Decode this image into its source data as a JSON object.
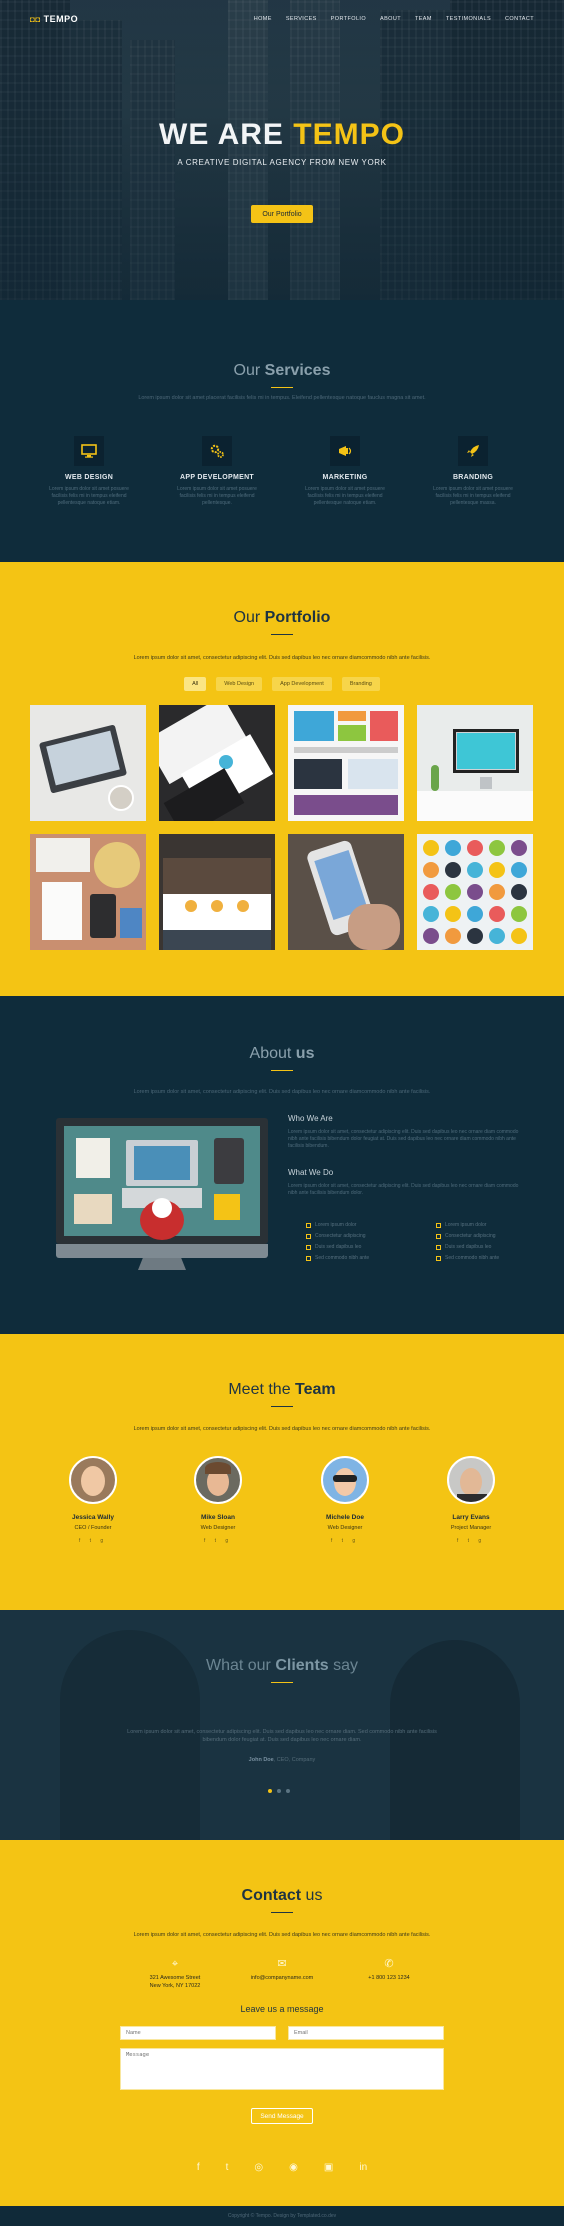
{
  "nav": {
    "logo_mark": "◘◘",
    "logo_text": "TEMPO",
    "items": [
      "HOME",
      "SERVICES",
      "PORTFOLIO",
      "ABOUT",
      "TEAM",
      "TESTIMONIALS",
      "CONTACT"
    ]
  },
  "hero": {
    "title_a": "WE ARE ",
    "title_b": "TEMPO",
    "subtitle": "A CREATIVE DIGITAL AGENCY FROM NEW YORK",
    "button": "Our Portfolio"
  },
  "services": {
    "title_a": "Our ",
    "title_b": "Services",
    "lead": "Lorem ipsum dolor sit amet placerat facilisis felis mi in tempus. Eleifend pellentesque natoque fauclus magna sit amet.",
    "items": [
      {
        "icon": "monitor-icon",
        "title": "WEB DESIGN",
        "text": "Lorem ipsum dolor sit amet posuere facilisis felis mi in tempus eleifend pellentesque natoque etiam."
      },
      {
        "icon": "cogs-icon",
        "title": "APP DEVELOPMENT",
        "text": "Lorem ipsum dolor sit amet posuere facilisis felis mi in tempus eleifend pellentesque."
      },
      {
        "icon": "megaphone-icon",
        "title": "MARKETING",
        "text": "Lorem ipsum dolor sit amet posuere facilisis felis mi in tempus eleifend pellentesque natoque etiam."
      },
      {
        "icon": "rocket-icon",
        "title": "BRANDING",
        "text": "Lorem ipsum dolor sit amet posuere facilisis felis mi in tempus eleifend pellentesque massa."
      }
    ]
  },
  "portfolio": {
    "title_a": "Our ",
    "title_b": "Portfolio",
    "lead": "Lorem ipsum dolor sit amet, consectetur adipiscing elit. Duis sed dapibus leo nec ornare diamcommodo nibh ante facilisis.",
    "filters": [
      "All",
      "Web Design",
      "App Development",
      "Branding"
    ]
  },
  "about": {
    "title_a": "About ",
    "title_b": "us",
    "lead": "Lorem ipsum dolor sit amet, consectetur adipiscing elit. Duis sed dapibus leo nec ornare diamcommodo nibh ante facilisis.",
    "who_title": "Who We Are",
    "who_text": "Lorem ipsum dolor sit amet, consectetur adipiscing elit. Duis sed dapibus leo nec ornare diam commodo nibh ante facilisis bibendum dolor feugiat at. Duis sed dapibus leo nec ornare diam commodo nibh ante facilisis bibendum.",
    "what_title": "What We Do",
    "what_text": "Lorem ipsum dolor sit amet, consectetur adipiscing elit. Duis sed dapibus leo nec ornare diam commodo nibh ante facilisis bibendum dolor.",
    "checks": [
      "Lorem ipsum dolor",
      "Consectetur adipiscing",
      "Duis sed dapibus leo",
      "Sed commodo nibh ante",
      "Lorem ipsum dolor",
      "Consectetur adipiscing",
      "Duis sed dapibus leo",
      "Sed commodo nibh ante"
    ]
  },
  "team": {
    "title_a": "Meet the ",
    "title_b": "Team",
    "lead": "Lorem ipsum dolor sit amet, consectetur adipiscing elit. Duis sed dapibus leo nec ornare diamcommodo nibh ante facilisis.",
    "social": "f  t  g",
    "members": [
      {
        "name": "Jessica Wally",
        "role": "CEO / Founder"
      },
      {
        "name": "Mike Sloan",
        "role": "Web Designer"
      },
      {
        "name": "Michele Doe",
        "role": "Web Designer"
      },
      {
        "name": "Larry Evans",
        "role": "Project Manager"
      }
    ]
  },
  "testimonials": {
    "title_a": "What our ",
    "title_b": "Clients",
    "title_c": " say",
    "quote": "Lorem ipsum dolor sit amet, consectetur adipiscing elit. Duis sed dapibus leo nec ornare diam. Sed commodo nibh ante facilisis bibendum dolor feugiat at. Duis sed dapibus leo nec ornare diam.",
    "author": "John Doe",
    "company": ", CEO, Company"
  },
  "contact": {
    "title_a": "Contact ",
    "title_b": "us",
    "lead": "Lorem ipsum dolor sit amet, consectetur adipiscing elit. Duis sed dapibus leo nec ornare diamcommodo nibh ante facilisis.",
    "address_1": "321 Awesome Street",
    "address_2": "New York, NY 17022",
    "email": "info@companyname.com",
    "phone": "+1 800 123 1234",
    "leave": "Leave us a message",
    "name_ph": "Name",
    "email_ph": "Email",
    "message_ph": "Message",
    "send": "Send Message",
    "social_icons": [
      "facebook-icon",
      "twitter-icon",
      "dribbble-icon",
      "github-icon",
      "instagram-icon",
      "linkedin-icon"
    ]
  },
  "footer": {
    "text": "Copyright © Tempo. Design by Templated.co.dev"
  },
  "colors": {
    "accent": "#f4c414",
    "dark": "#0f2c3b"
  }
}
